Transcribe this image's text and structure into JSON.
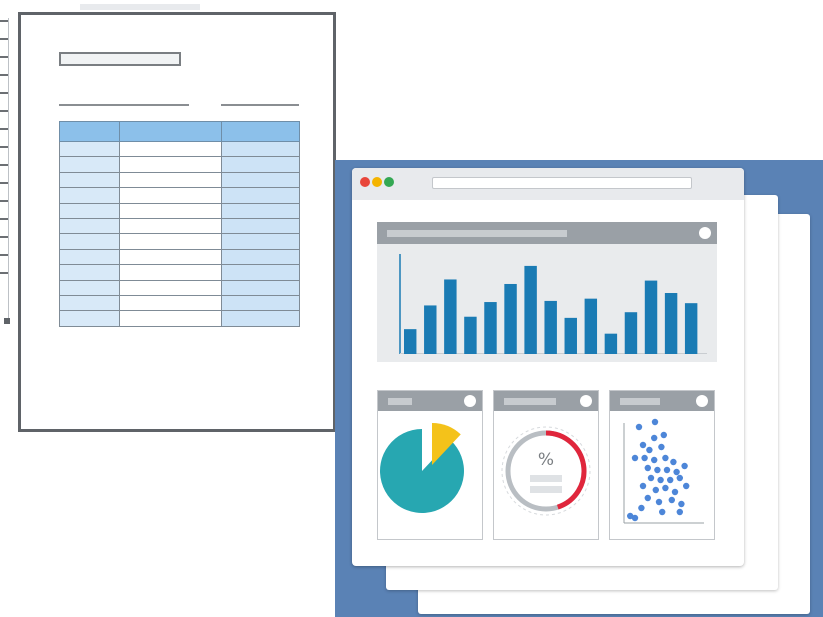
{
  "document": {
    "table_rows": 12,
    "colors": {
      "border": "#5f6368",
      "header": "#8cc0ea",
      "col_accent": "#cde3f6"
    }
  },
  "dashboard": {
    "window_buttons": [
      "red-dot",
      "yellow-dot",
      "green-dot"
    ],
    "colors": {
      "background": "#5a82b5",
      "bar": "#1a7bb4",
      "pie_main": "#27a7b1",
      "pie_slice": "#f4c21a",
      "gauge_arc": "#e0263c",
      "scatter": "#4d86d8"
    },
    "gauge_symbol": "%"
  },
  "chart_data": [
    {
      "type": "bar",
      "values": [
        22,
        43,
        66,
        33,
        46,
        62,
        78,
        47,
        32,
        49,
        18,
        37,
        65,
        54,
        45
      ],
      "ylim": [
        0,
        85
      ]
    },
    {
      "type": "pie",
      "values": [
        88,
        12
      ]
    },
    {
      "type": "gauge",
      "label": "%",
      "value": 0.45
    },
    {
      "type": "scatter",
      "points": [
        [
          15,
          93
        ],
        [
          35,
          98
        ],
        [
          20,
          75
        ],
        [
          34,
          82
        ],
        [
          46,
          85
        ],
        [
          28,
          70
        ],
        [
          43,
          73
        ],
        [
          10,
          62
        ],
        [
          22,
          62
        ],
        [
          34,
          60
        ],
        [
          48,
          62
        ],
        [
          58,
          58
        ],
        [
          26,
          52
        ],
        [
          38,
          50
        ],
        [
          50,
          50
        ],
        [
          62,
          48
        ],
        [
          72,
          54
        ],
        [
          30,
          42
        ],
        [
          42,
          40
        ],
        [
          54,
          40
        ],
        [
          66,
          42
        ],
        [
          20,
          34
        ],
        [
          36,
          30
        ],
        [
          48,
          32
        ],
        [
          60,
          28
        ],
        [
          74,
          34
        ],
        [
          26,
          22
        ],
        [
          40,
          18
        ],
        [
          56,
          20
        ],
        [
          68,
          16
        ],
        [
          18,
          12
        ],
        [
          44,
          8
        ],
        [
          66,
          8
        ],
        [
          4,
          4
        ],
        [
          10,
          2
        ]
      ]
    }
  ]
}
